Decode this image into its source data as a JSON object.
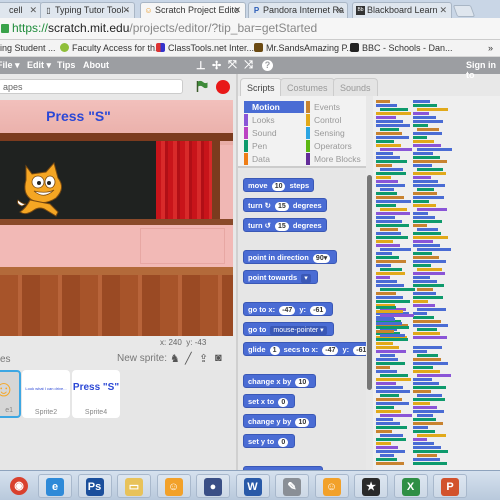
{
  "browser": {
    "tabs": [
      {
        "label": "cell",
        "icon": "page-icon",
        "active": false
      },
      {
        "label": "Typing Tutor Tool -",
        "icon": "page-icon",
        "active": false
      },
      {
        "label": "Scratch Project Edito",
        "icon": "scratch-icon",
        "active": true
      },
      {
        "label": "Pandora Internet Ra",
        "icon": "pandora-icon",
        "active": false
      },
      {
        "label": "Blackboard Learn",
        "icon": "blackboard-icon",
        "active": false
      }
    ],
    "url": {
      "scheme": "https://",
      "host": "scratch.mit.edu",
      "path": "/projects/editor/?tip_bar=getStarted"
    },
    "bookmarks": [
      {
        "label": "ing Student ..."
      },
      {
        "label": "Faculty Access for th..."
      },
      {
        "label": "ClassTools.net Inter..."
      },
      {
        "label": "Mr.SandsAmazing P..."
      },
      {
        "label": "BBC - Schools - Dan..."
      }
    ],
    "bookmarks_overflow": "»"
  },
  "menubar": {
    "items": [
      "File ▾",
      "Edit ▾",
      "Tips",
      "About"
    ],
    "sign_in": "Sign in to"
  },
  "stage": {
    "project_title": "apes",
    "label_text": "Press \"S\"",
    "coords": {
      "x_label": "x:",
      "x": "240",
      "y_label": "y:",
      "y": "-43"
    }
  },
  "sprites": {
    "header_label": "es",
    "new_sprite_label": "New sprite:",
    "items": [
      {
        "name": "e1",
        "thumb": "cat",
        "selected": true
      },
      {
        "name": "Sprite2",
        "thumb": "Look what I can drive...",
        "selected": false
      },
      {
        "name": "Sprite4",
        "thumb": "Press \"S\"",
        "selected": false
      }
    ]
  },
  "blocks_tabs": [
    "Scripts",
    "Costumes",
    "Sounds"
  ],
  "categories": [
    {
      "label": "Motion",
      "color": "#4a6cd4",
      "selected": true
    },
    {
      "label": "Looks",
      "color": "#8a55d7",
      "selected": false
    },
    {
      "label": "Sound",
      "color": "#bb42c3",
      "selected": false
    },
    {
      "label": "Pen",
      "color": "#0e9a6c",
      "selected": false
    },
    {
      "label": "Data",
      "color": "#ee7d16",
      "selected": false
    },
    {
      "label": "Events",
      "color": "#c88330",
      "selected": false
    },
    {
      "label": "Control",
      "color": "#e1a91a",
      "selected": false
    },
    {
      "label": "Sensing",
      "color": "#2ca5e2",
      "selected": false
    },
    {
      "label": "Operators",
      "color": "#5cb712",
      "selected": false
    },
    {
      "label": "More Blocks",
      "color": "#632d99",
      "selected": false
    }
  ],
  "motion_blocks": [
    {
      "parts": [
        {
          "t": "move"
        },
        {
          "s": "10"
        },
        {
          "t": "steps"
        }
      ]
    },
    {
      "parts": [
        {
          "t": "turn ↻"
        },
        {
          "s": "15"
        },
        {
          "t": "degrees"
        }
      ]
    },
    {
      "parts": [
        {
          "t": "turn ↺"
        },
        {
          "s": "15"
        },
        {
          "t": "degrees"
        }
      ]
    },
    {
      "parts": [
        {
          "t": "point in direction"
        },
        {
          "s": "90▾"
        }
      ]
    },
    {
      "parts": [
        {
          "t": "point towards"
        },
        {
          "d": "▾"
        }
      ]
    },
    {
      "parts": [
        {
          "t": "go to x:"
        },
        {
          "s": "-47"
        },
        {
          "t": "y:"
        },
        {
          "s": "-61"
        }
      ]
    },
    {
      "parts": [
        {
          "t": "go to"
        },
        {
          "d": "mouse-pointer ▾"
        }
      ]
    },
    {
      "parts": [
        {
          "t": "glide"
        },
        {
          "s": "1"
        },
        {
          "t": "secs to x:"
        },
        {
          "s": "-47"
        },
        {
          "t": "y:"
        },
        {
          "s": "-61"
        }
      ]
    },
    {
      "parts": [
        {
          "t": "change x by"
        },
        {
          "s": "10"
        }
      ]
    },
    {
      "parts": [
        {
          "t": "set x to"
        },
        {
          "s": "0"
        }
      ]
    },
    {
      "parts": [
        {
          "t": "change y by"
        },
        {
          "s": "10"
        }
      ]
    },
    {
      "parts": [
        {
          "t": "set y to"
        },
        {
          "s": "0"
        }
      ]
    }
  ],
  "taskbar": [
    {
      "app": "chrome-icon",
      "color": "#d9412e",
      "glyph": "◉"
    },
    {
      "app": "internet-explorer-icon",
      "color": "#2e8ad8",
      "glyph": "e"
    },
    {
      "app": "photoshop-icon",
      "color": "#1b4f9c",
      "glyph": "Ps"
    },
    {
      "app": "file-explorer-icon",
      "color": "#e8c25a",
      "glyph": "▭"
    },
    {
      "app": "scratch-icon",
      "color": "#f2a12a",
      "glyph": "☺"
    },
    {
      "app": "recorder-icon",
      "color": "#3a4f86",
      "glyph": "●"
    },
    {
      "app": "word-icon",
      "color": "#2a5aa8",
      "glyph": "W"
    },
    {
      "app": "tools-icon",
      "color": "#8a8f96",
      "glyph": "✎"
    },
    {
      "app": "scratch-icon",
      "color": "#f2a12a",
      "glyph": "☺"
    },
    {
      "app": "movie-maker-icon",
      "color": "#2a2a2a",
      "glyph": "★"
    },
    {
      "app": "excel-icon",
      "color": "#2f8f45",
      "glyph": "X"
    },
    {
      "app": "powerpoint-icon",
      "color": "#d2522c",
      "glyph": "P"
    }
  ]
}
